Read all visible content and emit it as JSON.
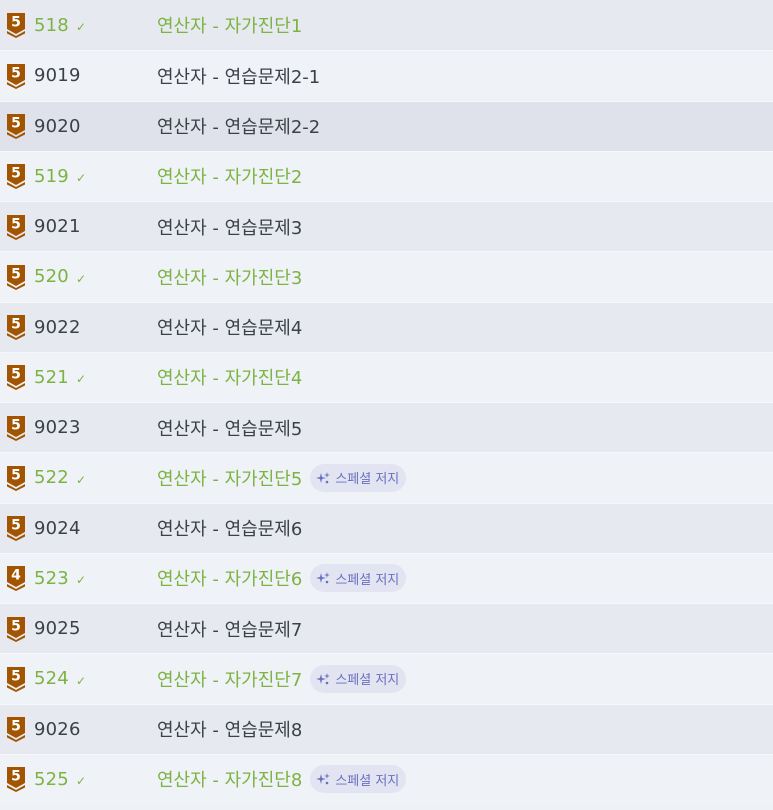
{
  "colors": {
    "solved_text": "#7cb342",
    "default_text": "#3c4148",
    "tier_bronze": "#a25400",
    "badge_text": "#6b6fbf",
    "badge_bg": "#e2e5f1"
  },
  "special_badge_label": "스페셜 저지",
  "problems": [
    {
      "tier": "5",
      "id": "518",
      "title": "연산자 - 자가진단1",
      "solved": true,
      "special": false
    },
    {
      "tier": "5",
      "id": "9019",
      "title": "연산자 - 연습문제2-1",
      "solved": false,
      "special": false
    },
    {
      "tier": "5",
      "id": "9020",
      "title": "연산자 - 연습문제2-2",
      "solved": false,
      "special": false
    },
    {
      "tier": "5",
      "id": "519",
      "title": "연산자 - 자가진단2",
      "solved": true,
      "special": false
    },
    {
      "tier": "5",
      "id": "9021",
      "title": "연산자 - 연습문제3",
      "solved": false,
      "special": false
    },
    {
      "tier": "5",
      "id": "520",
      "title": "연산자 - 자가진단3",
      "solved": true,
      "special": false
    },
    {
      "tier": "5",
      "id": "9022",
      "title": "연산자 - 연습문제4",
      "solved": false,
      "special": false
    },
    {
      "tier": "5",
      "id": "521",
      "title": "연산자 - 자가진단4",
      "solved": true,
      "special": false
    },
    {
      "tier": "5",
      "id": "9023",
      "title": "연산자 - 연습문제5",
      "solved": false,
      "special": false
    },
    {
      "tier": "5",
      "id": "522",
      "title": "연산자 - 자가진단5",
      "solved": true,
      "special": true
    },
    {
      "tier": "5",
      "id": "9024",
      "title": "연산자 - 연습문제6",
      "solved": false,
      "special": false
    },
    {
      "tier": "4",
      "id": "523",
      "title": "연산자 - 자가진단6",
      "solved": true,
      "special": true
    },
    {
      "tier": "5",
      "id": "9025",
      "title": "연산자 - 연습문제7",
      "solved": false,
      "special": false
    },
    {
      "tier": "5",
      "id": "524",
      "title": "연산자 - 자가진단7",
      "solved": true,
      "special": true
    },
    {
      "tier": "5",
      "id": "9026",
      "title": "연산자 - 연습문제8",
      "solved": false,
      "special": false
    },
    {
      "tier": "5",
      "id": "525",
      "title": "연산자 - 자가진단8",
      "solved": true,
      "special": true
    }
  ]
}
